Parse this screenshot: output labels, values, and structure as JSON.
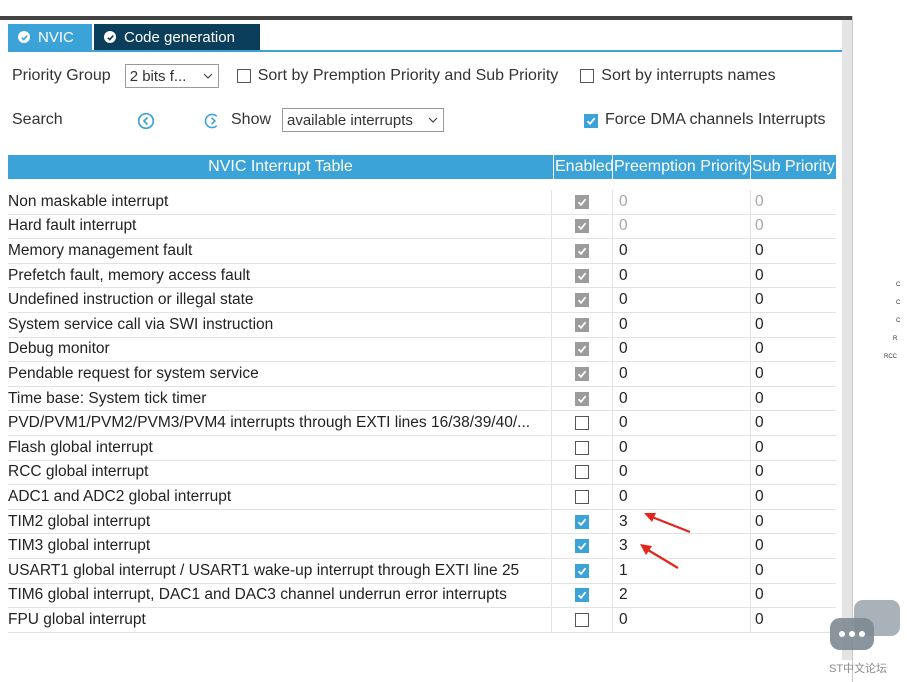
{
  "tabs": [
    {
      "label": "NVIC",
      "icon": "check-circle-icon",
      "active": true
    },
    {
      "label": "Code generation",
      "icon": "check-circle-icon",
      "active": false
    }
  ],
  "priority_group": {
    "label": "Priority Group",
    "value": "2 bits f..."
  },
  "sort_premption": {
    "label": "Sort by Premption Priority and Sub Priority",
    "checked": false
  },
  "sort_names": {
    "label": "Sort by interrupts names",
    "checked": false
  },
  "search": {
    "label": "Search"
  },
  "show": {
    "label": "Show",
    "value": "available interrupts"
  },
  "force_dma": {
    "label": "Force DMA channels Interrupts",
    "checked": true
  },
  "table": {
    "headers": {
      "name": "NVIC Interrupt Table",
      "enabled": "Enabled",
      "preemption": "Preemption Priority",
      "sub": "Sub Priority"
    },
    "rows": [
      {
        "name": "Non maskable interrupt",
        "enabled": true,
        "locked": true,
        "pre": "0",
        "sub": "0",
        "muted": true
      },
      {
        "name": "Hard fault interrupt",
        "enabled": true,
        "locked": true,
        "pre": "0",
        "sub": "0",
        "muted": true
      },
      {
        "name": "Memory management fault",
        "enabled": true,
        "locked": true,
        "pre": "0",
        "sub": "0",
        "muted": false
      },
      {
        "name": "Prefetch fault, memory access fault",
        "enabled": true,
        "locked": true,
        "pre": "0",
        "sub": "0",
        "muted": false
      },
      {
        "name": "Undefined instruction or illegal state",
        "enabled": true,
        "locked": true,
        "pre": "0",
        "sub": "0",
        "muted": false
      },
      {
        "name": "System service call via SWI instruction",
        "enabled": true,
        "locked": true,
        "pre": "0",
        "sub": "0",
        "muted": false
      },
      {
        "name": "Debug monitor",
        "enabled": true,
        "locked": true,
        "pre": "0",
        "sub": "0",
        "muted": false
      },
      {
        "name": "Pendable request for system service",
        "enabled": true,
        "locked": true,
        "pre": "0",
        "sub": "0",
        "muted": false
      },
      {
        "name": "Time base: System tick timer",
        "enabled": true,
        "locked": true,
        "pre": "0",
        "sub": "0",
        "muted": false
      },
      {
        "name": "PVD/PVM1/PVM2/PVM3/PVM4 interrupts through EXTI lines 16/38/39/40/...",
        "enabled": false,
        "locked": false,
        "pre": "0",
        "sub": "0",
        "muted": false
      },
      {
        "name": "Flash global interrupt",
        "enabled": false,
        "locked": false,
        "pre": "0",
        "sub": "0",
        "muted": false
      },
      {
        "name": "RCC global interrupt",
        "enabled": false,
        "locked": false,
        "pre": "0",
        "sub": "0",
        "muted": false
      },
      {
        "name": "ADC1 and ADC2 global interrupt",
        "enabled": false,
        "locked": false,
        "pre": "0",
        "sub": "0",
        "muted": false
      },
      {
        "name": "TIM2 global interrupt",
        "enabled": true,
        "locked": false,
        "pre": "3",
        "sub": "0",
        "muted": false
      },
      {
        "name": "TIM3 global interrupt",
        "enabled": true,
        "locked": false,
        "pre": "3",
        "sub": "0",
        "muted": false
      },
      {
        "name": "USART1 global interrupt / USART1 wake-up interrupt through EXTI line 25",
        "enabled": true,
        "locked": false,
        "pre": "1",
        "sub": "0",
        "muted": false
      },
      {
        "name": "TIM6 global interrupt, DAC1 and DAC3 channel underrun error interrupts",
        "enabled": true,
        "locked": false,
        "pre": "2",
        "sub": "0",
        "muted": false
      },
      {
        "name": "FPU global interrupt",
        "enabled": false,
        "locked": false,
        "pre": "0",
        "sub": "0",
        "muted": false
      }
    ]
  },
  "side_text": [
    "C",
    "C",
    "C",
    "R",
    "RCC"
  ],
  "watermark": {
    "text": "ST中文论坛"
  },
  "colors": {
    "accent": "#3ba3d8",
    "dark_tab": "#0b3e5a",
    "arrow": "#e0261d"
  }
}
